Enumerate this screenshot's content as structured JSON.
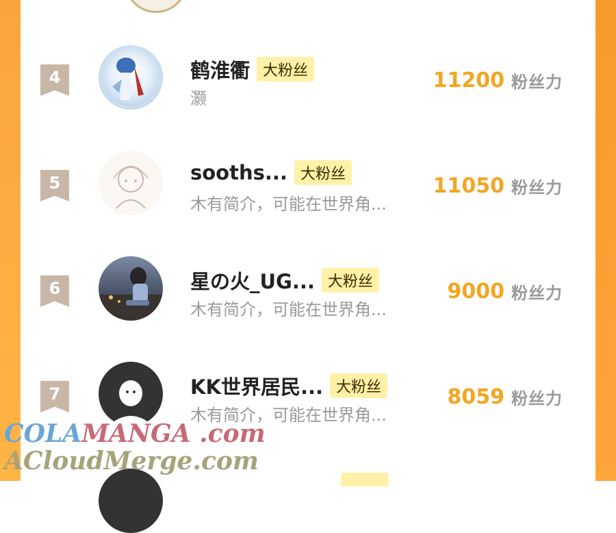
{
  "rows": [
    {
      "rank": "4",
      "name": "鹤淮衢",
      "tag": "大粉丝",
      "bio": "灏",
      "score": "11200",
      "score_label": "粉丝力"
    },
    {
      "rank": "5",
      "name": "sooths...",
      "tag": "大粉丝",
      "bio": "木有简介，可能在世界角...",
      "score": "11050",
      "score_label": "粉丝力"
    },
    {
      "rank": "6",
      "name": "星の火_UG...",
      "tag": "大粉丝",
      "bio": "木有简介，可能在世界角...",
      "score": "9000",
      "score_label": "粉丝力"
    },
    {
      "rank": "7",
      "name": "KK世界居民...",
      "tag": "大粉丝",
      "bio": "木有简介，可能在世界角...",
      "score": "8059",
      "score_label": "粉丝力"
    }
  ],
  "watermark": {
    "brand_a": "COLA",
    "brand_b": "MANGA",
    "brand_c": " .com",
    "line2": "ACloudMerge.com"
  },
  "colors": {
    "accent": "#f4a522",
    "side": "#f9a53e",
    "tag_bg": "#fff1a8"
  },
  "icons": {
    "rank": "bookmark-ribbon-icon",
    "avatar": "user-avatar"
  }
}
